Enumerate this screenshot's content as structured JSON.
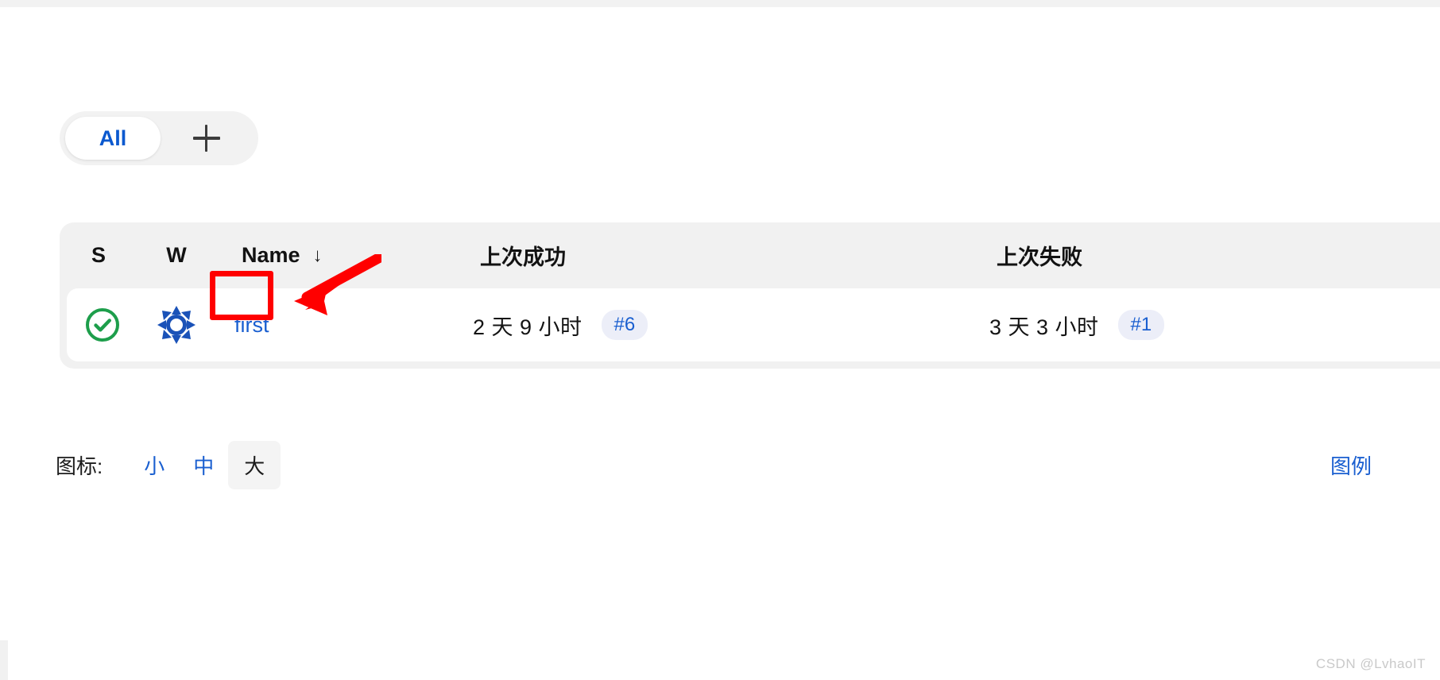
{
  "window": {
    "accent_blue": "#1a5fd0",
    "success_green": "#1d9e4b",
    "annotation_red": "#ff0000"
  },
  "filter_bar": {
    "all_label": "All",
    "add_icon": "plus-icon"
  },
  "table": {
    "columns": [
      {
        "key": "status",
        "label": "S"
      },
      {
        "key": "worker",
        "label": "W"
      },
      {
        "key": "name",
        "label": "Name",
        "sort_indicator": "↓"
      },
      {
        "key": "last_success",
        "label": "上次成功"
      },
      {
        "key": "last_failure",
        "label": "上次失败"
      }
    ],
    "rows": [
      {
        "status_icon": "check-circle-icon",
        "worker_icon": "burst-icon",
        "name": "first",
        "last_success_time": "2 天 9 小时",
        "last_success_badge": "#6",
        "last_failure_time": "3 天 3 小时",
        "last_failure_badge": "#1"
      }
    ]
  },
  "footer": {
    "icon_size_label": "图标:",
    "size_options": [
      {
        "label": "小",
        "selected": false
      },
      {
        "label": "中",
        "selected": false
      },
      {
        "label": "大",
        "selected": true
      }
    ],
    "legend_label": "图例"
  },
  "watermark": {
    "text": "CSDN @LvhaoIT"
  }
}
